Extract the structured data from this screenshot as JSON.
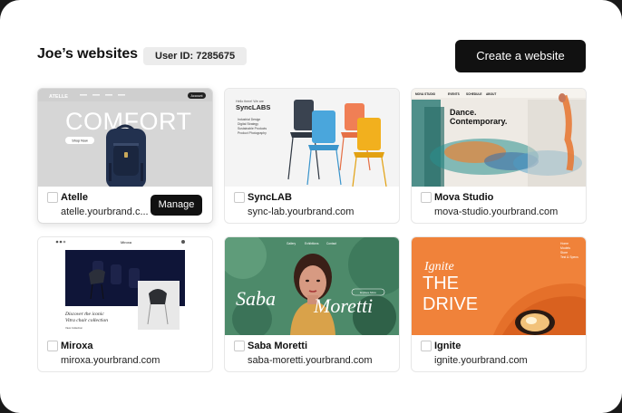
{
  "header": {
    "title": "Joe’s websites",
    "user_id": "User ID: 7285675",
    "create_label": "Create a website"
  },
  "sites": [
    {
      "name": "Atelle",
      "url": "atelle.yourbrand.c...",
      "manage_label": "Manage",
      "preview": {
        "brand": "ATELLE",
        "headline": "COMFORT",
        "cta": "Shop Now",
        "nav_button": "Account"
      }
    },
    {
      "name": "SyncLAB",
      "url": "sync-lab.yourbrand.com",
      "preview": {
        "intro": "Hello there! We are",
        "brand": "SyncLABS",
        "services": [
          "Industrial Design",
          "Digital Strategy",
          "Sustainable Products",
          "Product Photography"
        ]
      }
    },
    {
      "name": "Mova Studio",
      "url": "mova-studio.yourbrand.com",
      "preview": {
        "nav": [
          "MOVA STUDIO",
          "EVENTS",
          "SCHEDULE",
          "ABOUT"
        ],
        "headline": [
          "Dance.",
          "Contemporary."
        ]
      }
    },
    {
      "name": "Miroxa",
      "url": "miroxa.yourbrand.com",
      "preview": {
        "brand": "Miroxa",
        "tagline": [
          "Discover the iconic",
          "Vitra chair collection"
        ],
        "link": "View Collection"
      }
    },
    {
      "name": "Saba Moretti",
      "url": "saba-moretti.yourbrand.com",
      "preview": {
        "nav": [
          "Gallery",
          "Exhibitions",
          "Contact"
        ],
        "headline": [
          "Saba",
          "Moretti"
        ],
        "cta": "Explore More"
      }
    },
    {
      "name": "Ignite",
      "url": "ignite.yourbrand.com",
      "preview": {
        "headline": [
          "Ignite",
          "THE",
          "DRIVE"
        ],
        "menu": [
          "Home",
          "Models",
          "Store",
          "Test & Specs"
        ]
      }
    }
  ],
  "colors": {
    "primary_button": "#111111",
    "badge_bg": "#ececec",
    "card_border": "#e7e7e7",
    "ignite_orange": "#f0823a",
    "saba_green": "#4d8a6a",
    "mova_teal": "#2a8f8e"
  }
}
